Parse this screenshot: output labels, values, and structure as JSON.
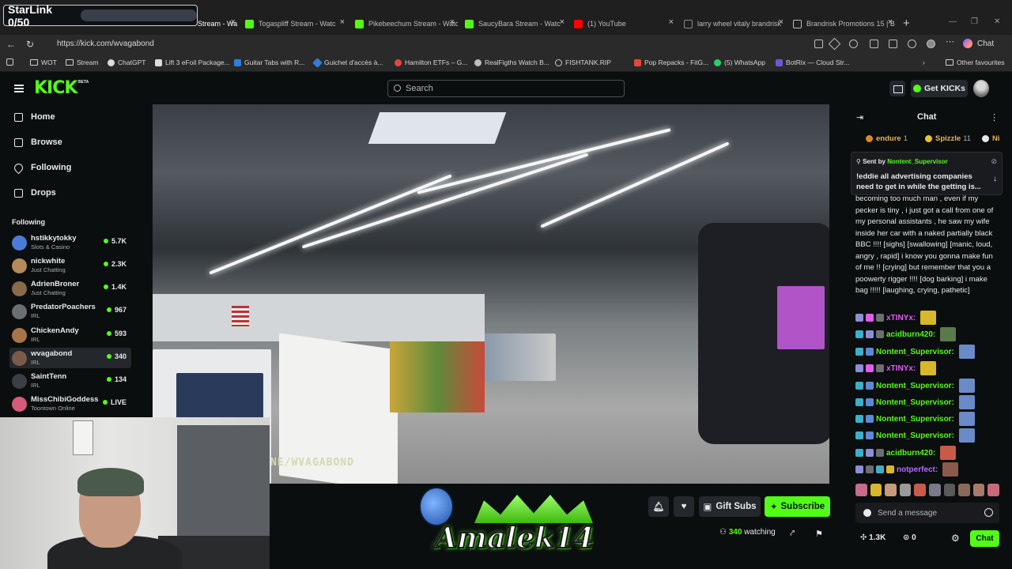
{
  "overlay": {
    "starlink_label": "StarLink 0/50",
    "starlink_progress": 0
  },
  "tabs": [
    {
      "label": "Stream - Wa",
      "icon": "kick-icon",
      "active": true
    },
    {
      "label": "Togaspliff Stream - Watc",
      "icon": "kick-icon",
      "active": false
    },
    {
      "label": "Pikebeechum Stream - Watc",
      "icon": "kick-icon",
      "active": false
    },
    {
      "label": "SaucyBara Stream - Watc",
      "icon": "kick-icon",
      "active": false
    },
    {
      "label": "(1) YouTube",
      "icon": "youtube-icon",
      "active": false
    },
    {
      "label": "larry wheel vitaly brandrisk",
      "icon": "search-icon",
      "active": false
    },
    {
      "label": "Brandrisk Promotions 15 | B",
      "icon": "page-icon",
      "active": false
    }
  ],
  "address": {
    "url": "https://kick.com/wvagabond"
  },
  "copilot_label": "Chat",
  "bookmarks": [
    "WOT",
    "Stream",
    "ChatGPT",
    "Lift 3 eFoil Package...",
    "Guitar Tabs with R...",
    "Guichet d'accès à...",
    "Hamilton ETFs – G...",
    "RealFigths Watch B...",
    "FISHTANK.RIP",
    "Pop Repacks - FitG...",
    "(5) WhatsApp",
    "BotRix — Cloud Str..."
  ],
  "bookmarks_other": "Other favourites",
  "header": {
    "logo": "KICK",
    "beta": "BETA",
    "search_placeholder": "Search",
    "get_kicks": "Get KICKs"
  },
  "nav": [
    {
      "label": "Home",
      "icon": "home-icon"
    },
    {
      "label": "Browse",
      "icon": "browse-icon"
    },
    {
      "label": "Following",
      "icon": "heart-icon"
    },
    {
      "label": "Drops",
      "icon": "drops-icon"
    }
  ],
  "following_heading": "Following",
  "following": [
    {
      "name": "hstikkytokky",
      "category": "Slots & Casino",
      "viewers": "5.7K"
    },
    {
      "name": "nickwhite",
      "category": "Just Chatting",
      "viewers": "2.3K"
    },
    {
      "name": "AdrienBroner",
      "category": "Just Chatting",
      "viewers": "1.4K"
    },
    {
      "name": "PredatorPoachers",
      "category": "IRL",
      "viewers": "967"
    },
    {
      "name": "ChickenAndy",
      "category": "IRL",
      "viewers": "593"
    },
    {
      "name": "wvagabond",
      "category": "IRL",
      "viewers": "340",
      "active": true
    },
    {
      "name": "SaintTenn",
      "category": "IRL",
      "viewers": "134"
    },
    {
      "name": "MissChibiGoddess",
      "category": "Toontown Online",
      "viewers": "LIVE"
    }
  ],
  "video": {
    "watermark": "NE/WVAGABOND"
  },
  "stream_logo": "Amalek14",
  "controls": {
    "gift_subs": "Gift Subs",
    "subscribe": "Subscribe",
    "watching_count": "340",
    "watching_label": "watching"
  },
  "chat": {
    "title": "Chat",
    "top_gifters": [
      {
        "name": "endure",
        "count": "1"
      },
      {
        "name": "Spizzle",
        "count": "11"
      },
      {
        "name": "Ni",
        "count": ""
      }
    ],
    "pinned": {
      "sent_by_label": "Sent by",
      "sent_by_user": "Nontent_Supervisor",
      "message": "!eddie all advertising companies need to get in while the getting is..."
    },
    "long_message": "becoming too much man , even if my pecker is tiny , i just got a call from one of my personal assistants , he saw my wife inside her car with a naked partially black BBC !!!! [sighs] [swallowing] [manic, loud, angry , rapid] i know you gonna make fun of me !! [crying] but remember that you a poowerty rigger !!!! [dog barking] i make bag !!!!! [laughing, crying, pathetic]",
    "messages": [
      {
        "user": "xTINYx:",
        "color": "#e25cf0"
      },
      {
        "user": "acidburn420:",
        "color": "#53fc18"
      },
      {
        "user": "Nontent_Supervisor:",
        "color": "#53fc18"
      },
      {
        "user": "xTINYx:",
        "color": "#e25cf0"
      },
      {
        "user": "Nontent_Supervisor:",
        "color": "#53fc18"
      },
      {
        "user": "Nontent_Supervisor:",
        "color": "#53fc18"
      },
      {
        "user": "Nontent_Supervisor:",
        "color": "#53fc18"
      },
      {
        "user": "Nontent_Supervisor:",
        "color": "#53fc18"
      },
      {
        "user": "acidburn420:",
        "color": "#53fc18"
      },
      {
        "user": "notperfect:",
        "color": "#b36bff"
      }
    ],
    "input_placeholder": "Send a message",
    "points": "1.3K",
    "kicks": "0",
    "send": "Chat"
  }
}
